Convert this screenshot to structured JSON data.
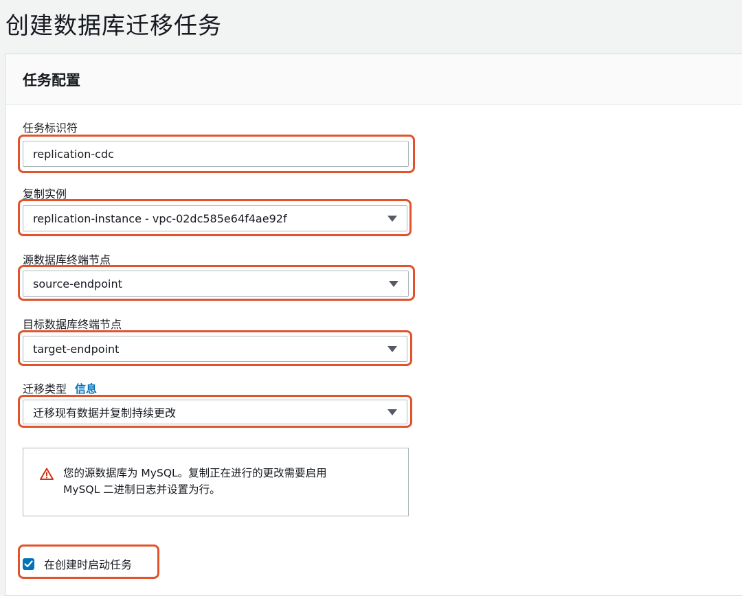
{
  "page": {
    "title": "创建数据库迁移任务"
  },
  "panel": {
    "title": "任务配置"
  },
  "task_identifier": {
    "label": "任务标识符",
    "value": "replication-cdc"
  },
  "replication_instance": {
    "label": "复制实例",
    "selected": "replication-instance - vpc-02dc585e64f4ae92f"
  },
  "source_endpoint": {
    "label": "源数据库终端节点",
    "selected": "source-endpoint"
  },
  "target_endpoint": {
    "label": "目标数据库终端节点",
    "selected": "target-endpoint"
  },
  "migration_type": {
    "label": "迁移类型",
    "info_link": "信息",
    "selected": "迁移现有数据并复制持续更改"
  },
  "alert": {
    "icon": "warning-icon",
    "line1": "您的源数据库为 MySQL。复制正在进行的更改需要启用",
    "line2": "MySQL 二进制日志并设置为行。"
  },
  "start_on_create": {
    "label": "在创建时启动任务",
    "checked": true
  },
  "colors": {
    "highlight": "#e2522b",
    "link": "#0073bb",
    "checkbox": "#0073bb",
    "warning": "#d13212"
  }
}
